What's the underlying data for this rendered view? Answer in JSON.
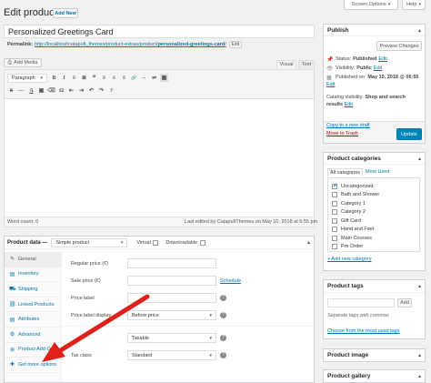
{
  "header": {
    "title": "Edit product",
    "add_new": "Add New",
    "screen_options": "Screen Options",
    "help": "Help"
  },
  "post": {
    "title_value": "Personalized Greetings Card",
    "permalink_label": "Permalink:",
    "permalink_base": "http://localhost/catapult_themes/product-extras/product/",
    "permalink_slug": "personalized-greetings-card",
    "permalink_end": "/",
    "edit_button": "Edit"
  },
  "editor": {
    "add_media": "Add Media",
    "tab_visual": "Visual",
    "tab_text": "Text",
    "format_select": "Paragraph",
    "toolbar": [
      "B",
      "I",
      "≡",
      "❝",
      "≣",
      "≡",
      "≡",
      "🔗",
      "⇔",
      "⇌",
      "▦"
    ],
    "word_count": "Word count: 0",
    "last_edited": "Last edited by CatapultThemes on May 10, 2018 at 6:55 pm"
  },
  "product_data": {
    "label": "Product data —",
    "type_select": "Simple product",
    "virtual_label": "Virtual:",
    "downloadable_label": "Downloadable:",
    "tabs": [
      {
        "icon": "✎",
        "label": "General"
      },
      {
        "icon": "▤",
        "label": "Inventory"
      },
      {
        "icon": "⛟",
        "label": "Shipping"
      },
      {
        "icon": "⛓",
        "label": "Linked Products"
      },
      {
        "icon": "▤",
        "label": "Attributes"
      },
      {
        "icon": "⚙",
        "label": "Advanced"
      },
      {
        "icon": "⊕",
        "label": "Product Add Ons"
      },
      {
        "icon": "✚",
        "label": "Get more options"
      }
    ],
    "fields": {
      "regular_price": "Regular price (€)",
      "sale_price": "Sale price (€)",
      "schedule": "Schedule",
      "price_label": "Price label",
      "price_label_display": "Price label display",
      "price_label_display_value": "Before price",
      "tax_status_value": "Taxable",
      "tax_class": "Tax class",
      "tax_class_value": "Standard",
      "help_icon": "?"
    }
  },
  "publish": {
    "title": "Publish",
    "preview_changes": "Preview Changes",
    "status_label": "Status:",
    "status_value": "Published",
    "visibility_label": "Visibility:",
    "visibility_value": "Public",
    "published_on": "Published on:",
    "published_date": "May 10, 2018 @ 06:55",
    "edit": "Edit",
    "catalog_visibility": "Catalog visibility:",
    "catalog_value_1": "Shop and search",
    "catalog_value_2": "results",
    "copy_draft": "Copy to a new draft",
    "move_trash": "Move to Trash",
    "update": "Update"
  },
  "categories": {
    "title": "Product categories",
    "tab_all": "All categories",
    "tab_used": "Most Used",
    "items": [
      {
        "label": "Uncategorized",
        "checked": true
      },
      {
        "label": "Bath and Shower",
        "checked": false
      },
      {
        "label": "Category 1",
        "checked": false
      },
      {
        "label": "Category 2",
        "checked": false
      },
      {
        "label": "Gift Card",
        "checked": false
      },
      {
        "label": "Hand and Feet",
        "checked": false
      },
      {
        "label": "Main Courses",
        "checked": false
      },
      {
        "label": "Pre Order",
        "checked": false
      }
    ],
    "add_new": "+ Add new category"
  },
  "tags": {
    "title": "Product tags",
    "add_button": "Add",
    "hint": "Separate tags with commas",
    "choose": "Choose from the most used tags"
  },
  "image": {
    "title": "Product image"
  },
  "gallery": {
    "title": "Product gallery"
  },
  "colors": {
    "accent": "#0073aa",
    "primary_btn": "#0085ba",
    "trash": "#a00",
    "arrow": "#e0201b"
  }
}
